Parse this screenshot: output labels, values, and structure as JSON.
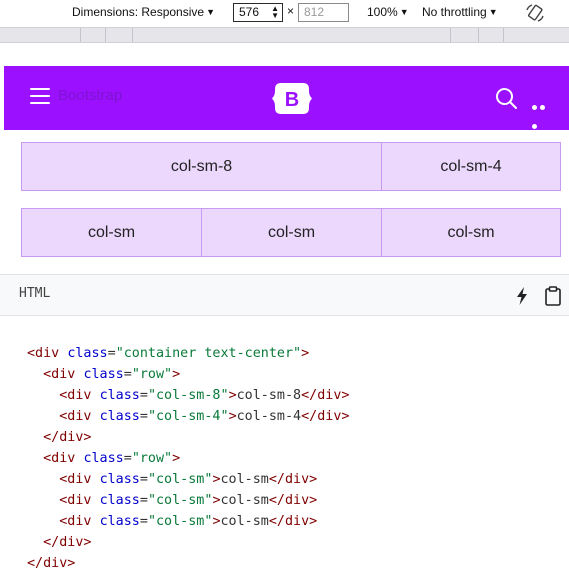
{
  "devtools": {
    "dimensions_label": "Dimensions: Responsive",
    "width_value": "576",
    "times": "×",
    "height_placeholder": "812",
    "zoom": "100%",
    "throttling": "No throttling"
  },
  "navbar": {
    "ghost_text": "Bootstrap",
    "brand_letter": "B",
    "color": "#9b10ff"
  },
  "grid": {
    "row1": [
      "col-sm-8",
      "col-sm-4"
    ],
    "row2": [
      "col-sm",
      "col-sm",
      "col-sm"
    ]
  },
  "code": {
    "language": "HTML",
    "lines": [
      [
        [
          "tg",
          "<div "
        ],
        [
          "at",
          "class"
        ],
        [
          "pn",
          "="
        ],
        [
          "st",
          "\"container text-center\""
        ],
        [
          "tg",
          ">"
        ]
      ],
      [
        [
          "tg",
          "  <div "
        ],
        [
          "at",
          "class"
        ],
        [
          "pn",
          "="
        ],
        [
          "st",
          "\"row\""
        ],
        [
          "tg",
          ">"
        ]
      ],
      [
        [
          "tg",
          "    <div "
        ],
        [
          "at",
          "class"
        ],
        [
          "pn",
          "="
        ],
        [
          "st",
          "\"col-sm-8\""
        ],
        [
          "tg",
          ">"
        ],
        [
          "pn",
          "col-sm-8"
        ],
        [
          "tg",
          "</div>"
        ]
      ],
      [
        [
          "tg",
          "    <div "
        ],
        [
          "at",
          "class"
        ],
        [
          "pn",
          "="
        ],
        [
          "st",
          "\"col-sm-4\""
        ],
        [
          "tg",
          ">"
        ],
        [
          "pn",
          "col-sm-4"
        ],
        [
          "tg",
          "</div>"
        ]
      ],
      [
        [
          "tg",
          "  </div>"
        ]
      ],
      [
        [
          "tg",
          "  <div "
        ],
        [
          "at",
          "class"
        ],
        [
          "pn",
          "="
        ],
        [
          "st",
          "\"row\""
        ],
        [
          "tg",
          ">"
        ]
      ],
      [
        [
          "tg",
          "    <div "
        ],
        [
          "at",
          "class"
        ],
        [
          "pn",
          "="
        ],
        [
          "st",
          "\"col-sm\""
        ],
        [
          "tg",
          ">"
        ],
        [
          "pn",
          "col-sm"
        ],
        [
          "tg",
          "</div>"
        ]
      ],
      [
        [
          "tg",
          "    <div "
        ],
        [
          "at",
          "class"
        ],
        [
          "pn",
          "="
        ],
        [
          "st",
          "\"col-sm\""
        ],
        [
          "tg",
          ">"
        ],
        [
          "pn",
          "col-sm"
        ],
        [
          "tg",
          "</div>"
        ]
      ],
      [
        [
          "tg",
          "    <div "
        ],
        [
          "at",
          "class"
        ],
        [
          "pn",
          "="
        ],
        [
          "st",
          "\"col-sm\""
        ],
        [
          "tg",
          ">"
        ],
        [
          "pn",
          "col-sm"
        ],
        [
          "tg",
          "</div>"
        ]
      ],
      [
        [
          "tg",
          "  </div>"
        ]
      ],
      [
        [
          "tg",
          "</div>"
        ]
      ]
    ]
  }
}
